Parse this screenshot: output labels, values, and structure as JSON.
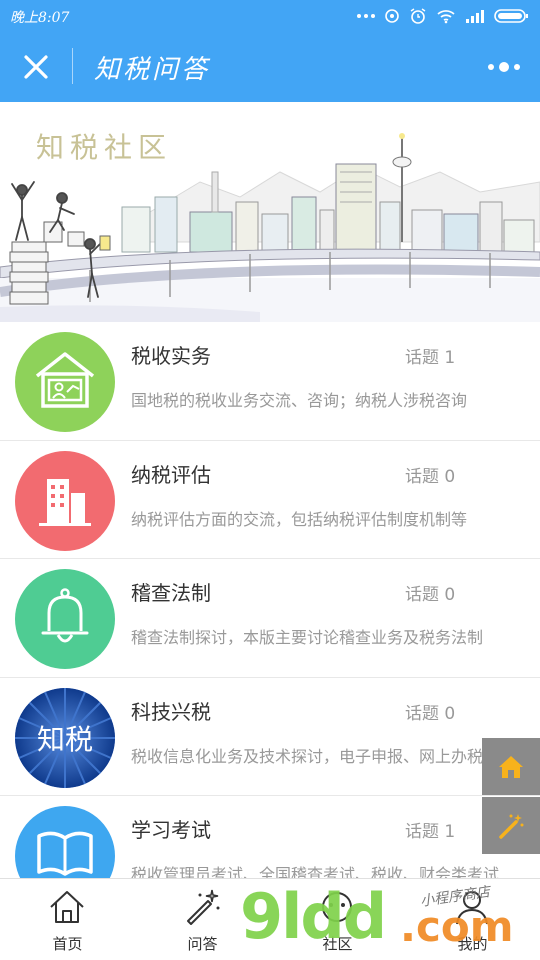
{
  "status_bar": {
    "time": "晚上8:07"
  },
  "header": {
    "title": "知税问答"
  },
  "banner": {
    "title": "知税社区"
  },
  "categories": [
    {
      "name": "税收实务",
      "topic": "话题 1",
      "desc": "国地税的税收业务交流、咨询；纳税人涉税咨询",
      "icon": "house-chart-icon",
      "color": "#8ed25a"
    },
    {
      "name": "纳税评估",
      "topic": "话题 0",
      "desc": "纳税评估方面的交流，包括纳税评估制度机制等",
      "icon": "building-icon",
      "color": "#f26b70"
    },
    {
      "name": "稽查法制",
      "topic": "话题 0",
      "desc": "稽查法制探讨，本版主要讨论稽查业务及税务法制",
      "icon": "bell-icon",
      "color": "#4fcc93"
    },
    {
      "name": "科技兴税",
      "topic": "话题 0",
      "desc": "税收信息化业务及技术探讨，电子申报、网上办税",
      "icon": "zhishui-logo",
      "color": "#1e4fb0",
      "logo_text": "知税"
    },
    {
      "name": "学习考试",
      "topic": "话题 1",
      "desc": "税收管理员考试、全国稽查考试、税收、财会类考试",
      "icon": "book-icon",
      "color": "#3ea7f0"
    }
  ],
  "side_buttons": [
    {
      "icon": "home-icon"
    },
    {
      "icon": "magic-wand-icon"
    }
  ],
  "tabs": [
    {
      "label": "首页",
      "icon": "home-outline-icon"
    },
    {
      "label": "问答",
      "icon": "magic-wand-outline-icon"
    },
    {
      "label": "社区",
      "icon": "community-icon"
    },
    {
      "label": "我的",
      "icon": "user-icon"
    }
  ],
  "watermark": {
    "brand": "9ldd",
    "suffix": ".com",
    "tagline": "小程序商店"
  }
}
